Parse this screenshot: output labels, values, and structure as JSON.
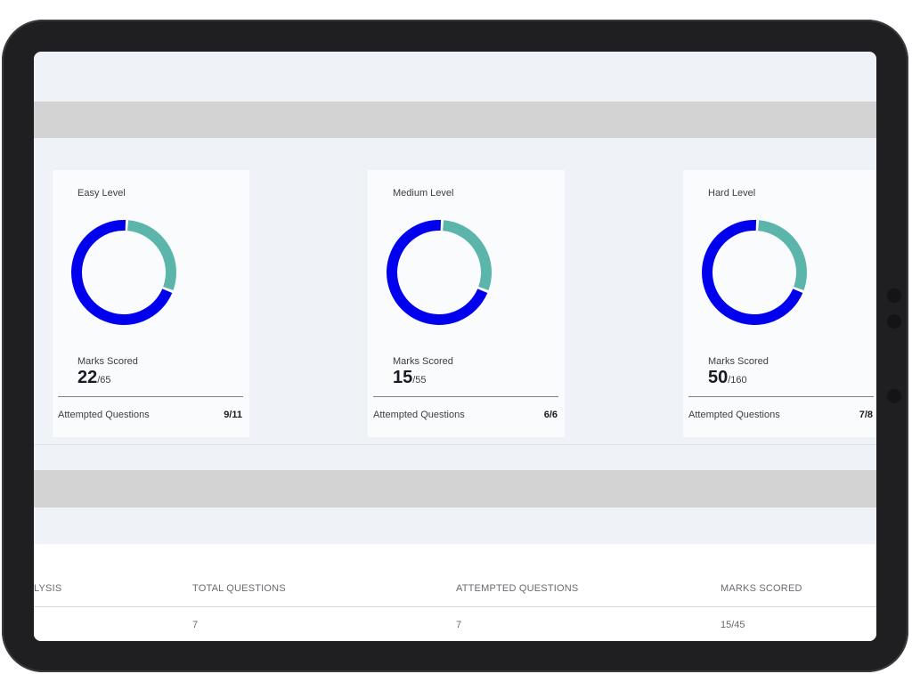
{
  "level_cards": [
    {
      "title": "Easy Level",
      "marks_label": "Marks Scored",
      "score": "22",
      "total": "/65",
      "attempted_label": "Attempted Questions",
      "attempted_value": "9/11"
    },
    {
      "title": "Medium Level",
      "marks_label": "Marks Scored",
      "score": "15",
      "total": "/55",
      "attempted_label": "Attempted Questions",
      "attempted_value": "6/6"
    },
    {
      "title": "Hard Level",
      "marks_label": "Marks Scored",
      "score": "50",
      "total": "/160",
      "attempted_label": "Attempted Questions",
      "attempted_value": "7/8"
    }
  ],
  "donut_colors": {
    "primary": "#0000ee",
    "secondary": "#5bb5aa"
  },
  "donut_fractions": {
    "primary": 0.7,
    "secondary": 0.3
  },
  "table": {
    "headers": [
      "LYSIS",
      "TOTAL QUESTIONS",
      "ATTEMPTED QUESTIONS",
      "MARKS SCORED"
    ],
    "row": [
      "",
      "7",
      "7",
      "15/45"
    ]
  }
}
